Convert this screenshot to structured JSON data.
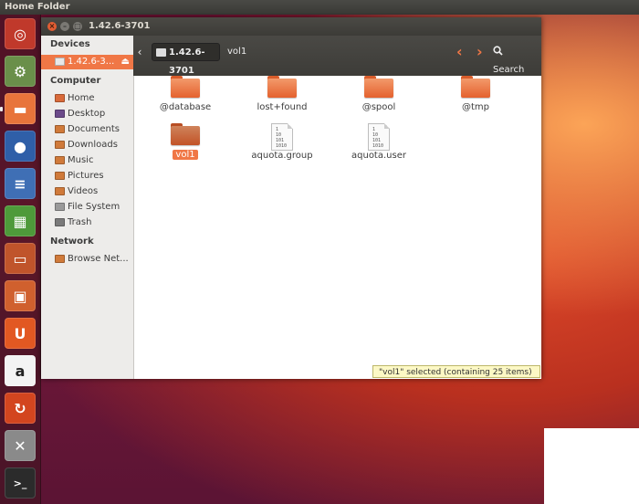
{
  "top_panel": {
    "title": "Home Folder"
  },
  "window": {
    "title": "1.42.6-3701",
    "buttons": {
      "close": "×",
      "minimize": "–",
      "maximize": "□"
    }
  },
  "toolbar": {
    "back_glyph": "‹",
    "path": [
      {
        "label": "1.42.6-3701",
        "active": true
      },
      {
        "label": "vol1",
        "active": false
      }
    ],
    "prev_glyph": "‹",
    "next_glyph": "›",
    "search_label": "Search"
  },
  "sidebar": {
    "sections": [
      {
        "header": "Devices",
        "items": [
          {
            "label": "1.42.6-3...",
            "icon": "drive-icon",
            "selected": true,
            "eject": "⏏"
          }
        ]
      },
      {
        "header": "Computer",
        "items": [
          {
            "label": "Home",
            "icon": "home-icon"
          },
          {
            "label": "Desktop",
            "icon": "desktop-icon"
          },
          {
            "label": "Documents",
            "icon": "documents-icon"
          },
          {
            "label": "Downloads",
            "icon": "downloads-icon"
          },
          {
            "label": "Music",
            "icon": "music-icon"
          },
          {
            "label": "Pictures",
            "icon": "pictures-icon"
          },
          {
            "label": "Videos",
            "icon": "videos-icon"
          },
          {
            "label": "File System",
            "icon": "filesystem-icon"
          },
          {
            "label": "Trash",
            "icon": "trash-icon"
          }
        ]
      },
      {
        "header": "Network",
        "items": [
          {
            "label": "Browse Net...",
            "icon": "network-icon"
          }
        ]
      }
    ]
  },
  "files": [
    {
      "name": "@database",
      "type": "folder"
    },
    {
      "name": "lost+found",
      "type": "folder"
    },
    {
      "name": "@spool",
      "type": "folder"
    },
    {
      "name": "@tmp",
      "type": "folder"
    },
    {
      "name": "vol1",
      "type": "folder",
      "selected": true
    },
    {
      "name": "aquota.group",
      "type": "binary",
      "preview": "1\n10\n101\n1010"
    },
    {
      "name": "aquota.user",
      "type": "binary",
      "preview": "1\n10\n101\n1010"
    }
  ],
  "status": {
    "text": "\"vol1\" selected (containing 25 items)"
  },
  "launcher": {
    "items": [
      {
        "name": "dash-icon",
        "glyph": "◎",
        "bg": "#c0392b"
      },
      {
        "name": "system-settings-icon",
        "glyph": "⚙",
        "bg": "#6a8f4a"
      },
      {
        "name": "files-icon",
        "glyph": "▬",
        "bg": "#e8743b"
      },
      {
        "name": "firefox-icon",
        "glyph": "●",
        "bg": "#2f5fa8"
      },
      {
        "name": "writer-icon",
        "glyph": "≡",
        "bg": "#3f6fb5"
      },
      {
        "name": "calc-icon",
        "glyph": "▦",
        "bg": "#4e9a3a"
      },
      {
        "name": "impress-icon",
        "glyph": "▭",
        "bg": "#c0542b"
      },
      {
        "name": "software-center-icon",
        "glyph": "▣",
        "bg": "#d0602e"
      },
      {
        "name": "ubuntu-one-icon",
        "glyph": "U",
        "bg": "#e25822"
      },
      {
        "name": "amazon-icon",
        "glyph": "a",
        "bg": "#f3f3f3"
      },
      {
        "name": "update-manager-icon",
        "glyph": "↻",
        "bg": "#d3451f"
      },
      {
        "name": "settings-tools-icon",
        "glyph": "✕",
        "bg": "#8a8a8a"
      },
      {
        "name": "terminal-icon",
        "glyph": ">_",
        "bg": "#2b2b2b"
      }
    ]
  },
  "colors": {
    "accent": "#f07746",
    "panel": "#3c3b37",
    "folder": "#e4612e"
  }
}
